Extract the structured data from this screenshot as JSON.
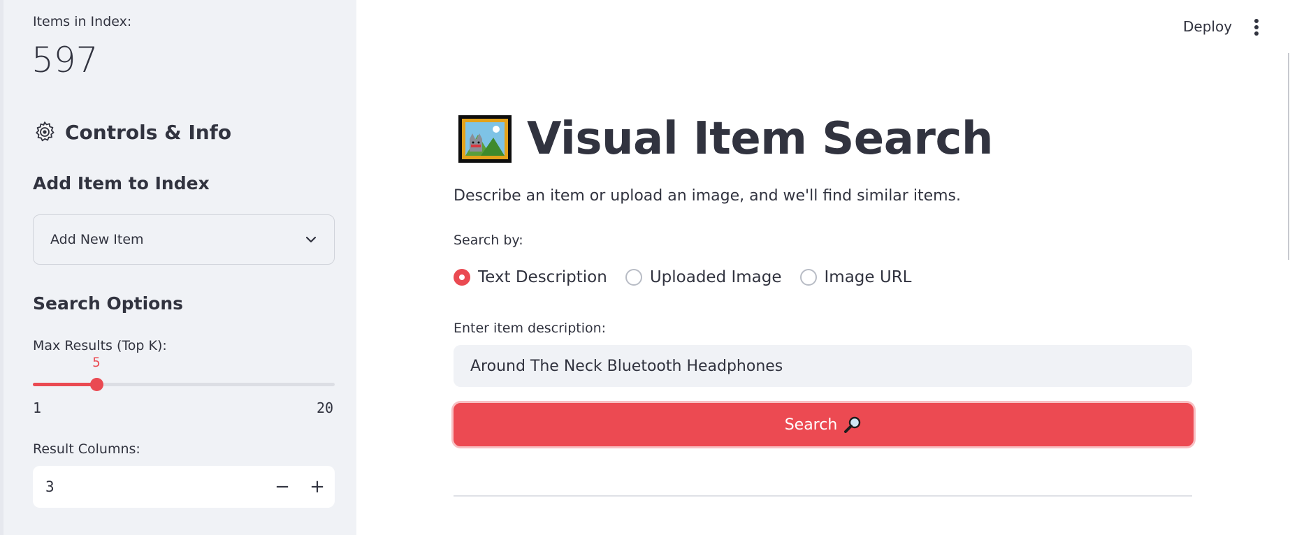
{
  "sidebar": {
    "metric": {
      "label": "Items in Index:",
      "value": "597"
    },
    "header": {
      "title": "Controls & Info",
      "icon": "gear-icon"
    },
    "add_item": {
      "title": "Add Item to Index",
      "expander_label": "Add New Item"
    },
    "search_options": {
      "title": "Search Options",
      "slider": {
        "label": "Max Results (Top K):",
        "value": 5,
        "min": 1,
        "max": 20,
        "value_text": "5",
        "min_text": "1",
        "max_text": "20"
      },
      "columns": {
        "label": "Result Columns:",
        "value": "3",
        "minus": "−",
        "plus": "+"
      }
    }
  },
  "header": {
    "deploy_label": "Deploy",
    "menu_icon": "more-vertical-icon"
  },
  "main": {
    "title": "Visual Item Search",
    "title_icon": "framed-picture-icon",
    "subtitle": "Describe an item or upload an image, and we'll find similar items.",
    "search_by": {
      "label": "Search by:",
      "options": [
        "Text Description",
        "Uploaded Image",
        "Image URL"
      ],
      "selected": "Text Description"
    },
    "description_input": {
      "label": "Enter item description:",
      "value": "Around The Neck Bluetooth Headphones"
    },
    "search_button": {
      "label": "Search",
      "icon": "magnifier-icon"
    }
  },
  "colors": {
    "accent": "#ec4a52",
    "sidebar_bg": "#f0f2f6",
    "text": "#31333f"
  }
}
